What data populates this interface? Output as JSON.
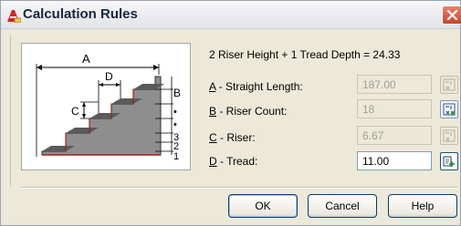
{
  "window": {
    "title": "Calculation Rules",
    "icon": "app-stair-icon",
    "close_icon": "close-icon"
  },
  "diagram": {
    "labels": {
      "A": "A",
      "B": "B",
      "C": "C",
      "D": "D",
      "n1": "1",
      "n2": "2",
      "n3": "3",
      "dot": "•"
    }
  },
  "formula": "2 Riser Height + 1 Tread Depth = 24.33",
  "fields": [
    {
      "letter": "A",
      "rest": " - Straight Length:",
      "value": "187.00",
      "enabled": false,
      "button_icon": "calculator-disabled-icon"
    },
    {
      "letter": "B",
      "rest": " - Riser Count:",
      "value": "18",
      "enabled": false,
      "button_icon": "calculator-active-icon"
    },
    {
      "letter": "C",
      "rest": " - Riser:",
      "value": "6.67",
      "enabled": false,
      "button_icon": "calculator-disabled-icon"
    },
    {
      "letter": "D",
      "rest": " - Tread:",
      "value": "11.00",
      "enabled": true,
      "button_icon": "edit-value-icon"
    }
  ],
  "buttons": {
    "ok": "OK",
    "cancel": "Cancel",
    "help": "Help"
  },
  "colors": {
    "dialog_bg": "#ece9d8",
    "title_text": "#15263e",
    "close_red": "#c6452c",
    "button_border": "#003c74",
    "stair_dark": "#3d3d3d",
    "stair_accent": "#a12020"
  }
}
